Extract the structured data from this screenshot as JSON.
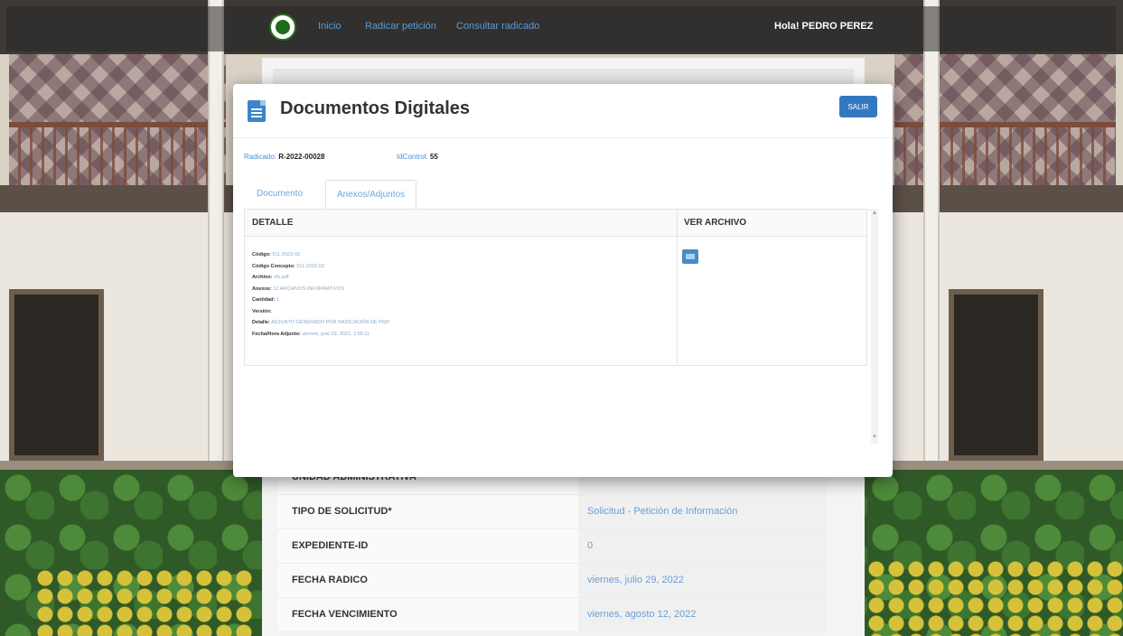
{
  "navbar": {
    "links": [
      "Inicio",
      "Radicar petición",
      "Consultar radicado"
    ],
    "greeting": "Hola! PEDRO PEREZ"
  },
  "background_form": {
    "rows": [
      {
        "label": "UNIDAD ADMINISTRATIVA",
        "value": ""
      },
      {
        "label": "TIPO DE SOLICITUD*",
        "value": "Solicitud - Petición de Información"
      },
      {
        "label": "EXPEDIENTE-ID",
        "value": "0"
      },
      {
        "label": "FECHA RADICO",
        "value": "viernes, julio 29, 2022"
      },
      {
        "label": "FECHA VENCIMIENTO",
        "value": "viernes, agosto 12, 2022"
      }
    ]
  },
  "modal": {
    "title": "Documentos Digitales",
    "salir_label": "SALIR",
    "radicado_label": "Radicado:",
    "radicado_value": "R-2022-00028",
    "idcontrol_label": "IdControl:",
    "idcontrol_value": "55",
    "tabs": [
      "Documento",
      "Anexos/Adjuntos"
    ],
    "active_tab": "Anexos/Adjuntos",
    "grid": {
      "headers": [
        "DETALLE",
        "VER ARCHIVO"
      ],
      "detail_lines": [
        {
          "label": "Código:",
          "value": "511-2022-02"
        },
        {
          "label": "Código Concepto:",
          "value": "511-2022-02"
        },
        {
          "label": "Archivo:",
          "value": "ofs.pdf"
        },
        {
          "label": "Anexos:",
          "value": "12 ARCHIVOS INFORMATIVOS"
        },
        {
          "label": "Cantidad:",
          "value": "1"
        },
        {
          "label": "Versión:",
          "value": ""
        },
        {
          "label": "Detalle:",
          "value": "ADJUNTO GENERADO POR RADICACIÓN DE PQR"
        },
        {
          "label": "Fecha/Hora Adjunto:",
          "value": "viernes, julio 29, 2022, 3:55:11"
        }
      ],
      "file_icon": "image-file-icon"
    }
  },
  "colors": {
    "accent": "#3379c2",
    "link": "#5b9bd5"
  }
}
